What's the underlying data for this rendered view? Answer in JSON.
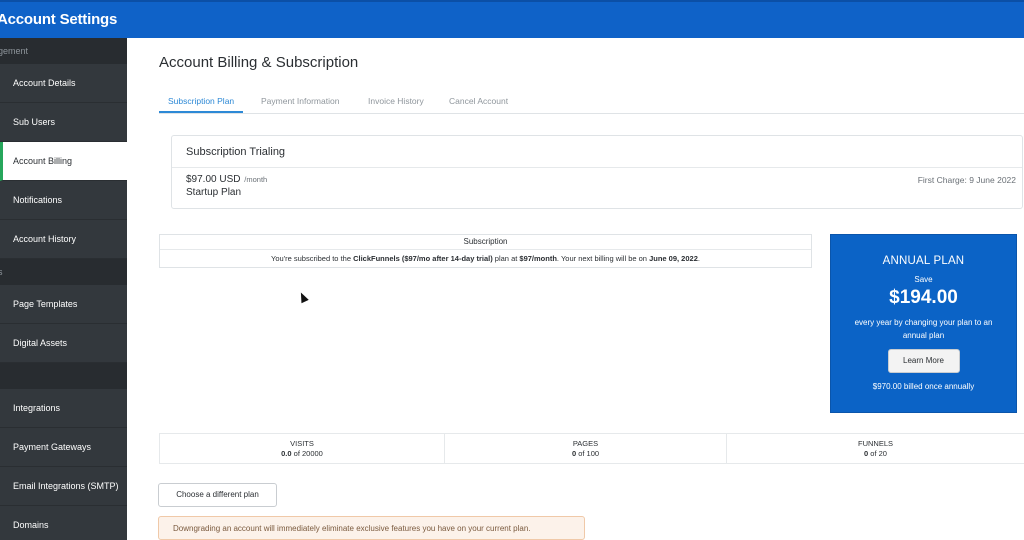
{
  "app_title": "Account Settings",
  "sidebar": {
    "section_1": "gement",
    "items_1": [
      {
        "label": "Account Details"
      },
      {
        "label": "Sub Users"
      },
      {
        "label": "Account Billing"
      },
      {
        "label": "Notifications"
      },
      {
        "label": "Account History"
      }
    ],
    "section_2": "s",
    "items_2": [
      {
        "label": "Page Templates"
      },
      {
        "label": "Digital Assets"
      }
    ],
    "section_3": "",
    "items_3": [
      {
        "label": "Integrations"
      },
      {
        "label": "Payment Gateways"
      },
      {
        "label": "Email Integrations (SMTP)"
      },
      {
        "label": "Domains"
      }
    ]
  },
  "page_title": "Account Billing & Subscription",
  "tabs": [
    {
      "label": "Subscription Plan"
    },
    {
      "label": "Payment Information"
    },
    {
      "label": "Invoice History"
    },
    {
      "label": "Cancel Account"
    }
  ],
  "subscription_card": {
    "title": "Subscription Trialing",
    "price": "$97.00 USD",
    "period": "/month",
    "plan": "Startup Plan",
    "first_charge": "First Charge: 9 June 2022"
  },
  "subscription_table": {
    "header": "Subscription",
    "text_1": "You're subscribed to the ",
    "plan_name": "ClickFunnels ($97/mo after 14-day trial)",
    "text_2": " plan at ",
    "price": "$97/month",
    "text_3": ". Your next billing will be on ",
    "next_billing": "June 09, 2022",
    "text_4": "."
  },
  "annual_plan": {
    "title": "ANNUAL PLAN",
    "save_label": "Save",
    "amount": "$194.00",
    "description": "every year by changing your plan to an annual plan",
    "button": "Learn More",
    "billed": "$970.00 billed once annually",
    "color": "#0b63c6"
  },
  "stats": [
    {
      "label": "VISITS",
      "value": "0.0",
      "suffix": " of 20000"
    },
    {
      "label": "PAGES",
      "value": "0",
      "suffix": " of 100"
    },
    {
      "label": "FUNNELS",
      "value": "0",
      "suffix": " of 20"
    }
  ],
  "change_plan_button": "Choose a different plan",
  "warning": "Downgrading an account will immediately eliminate exclusive features you have on your current plan.",
  "colors": {
    "topbar": "#0f62c8",
    "sidebar": "#33383d",
    "active_accent": "#26a65b",
    "tab_active": "#2d89d6"
  }
}
